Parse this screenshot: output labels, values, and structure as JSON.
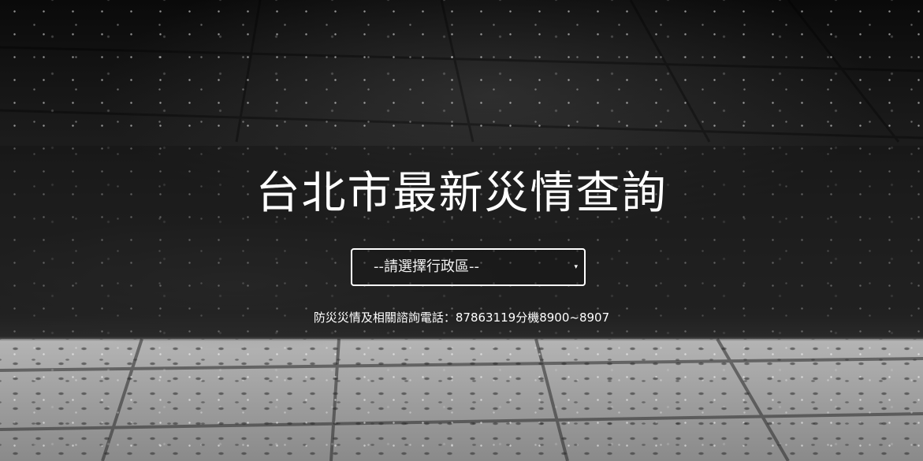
{
  "hero": {
    "title": "台北市最新災情查詢",
    "district_select": {
      "selected": "--請選擇行政區--"
    },
    "contact": "防災災情及相關諮詢電話：87863119分機8900~8907"
  },
  "icons": {
    "dropdown_caret": "▾"
  },
  "colors": {
    "text": "#ffffff",
    "overlay_band": "rgba(20,20,20,0.45)"
  }
}
